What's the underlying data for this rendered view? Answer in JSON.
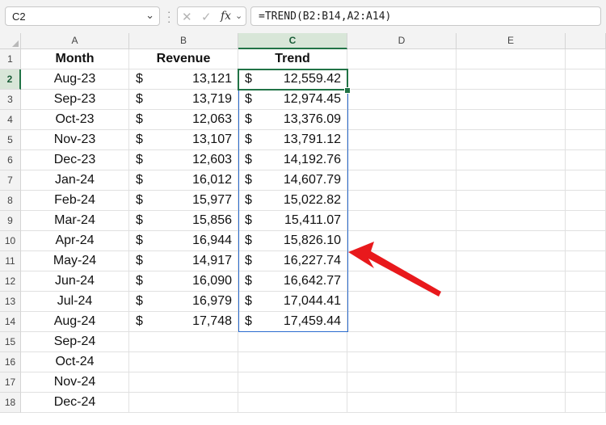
{
  "name_box": {
    "value": "C2"
  },
  "formula_bar": {
    "formula": "=TREND(B2:B14,A2:A14)",
    "fx_label": "fx"
  },
  "columns": [
    "A",
    "B",
    "C",
    "D",
    "E"
  ],
  "row_numbers": [
    "1",
    "2",
    "3",
    "4",
    "5",
    "6",
    "7",
    "8",
    "9",
    "10",
    "11",
    "12",
    "13",
    "14",
    "15",
    "16",
    "17",
    "18"
  ],
  "headers": {
    "month": "Month",
    "revenue": "Revenue",
    "trend": "Trend"
  },
  "currency_symbol": "$",
  "rows": [
    {
      "month": "Aug-23",
      "revenue": "13,121",
      "trend": "12,559.42"
    },
    {
      "month": "Sep-23",
      "revenue": "13,719",
      "trend": "12,974.45"
    },
    {
      "month": "Oct-23",
      "revenue": "12,063",
      "trend": "13,376.09"
    },
    {
      "month": "Nov-23",
      "revenue": "13,107",
      "trend": "13,791.12"
    },
    {
      "month": "Dec-23",
      "revenue": "12,603",
      "trend": "14,192.76"
    },
    {
      "month": "Jan-24",
      "revenue": "16,012",
      "trend": "14,607.79"
    },
    {
      "month": "Feb-24",
      "revenue": "15,977",
      "trend": "15,022.82"
    },
    {
      "month": "Mar-24",
      "revenue": "15,856",
      "trend": "15,411.07"
    },
    {
      "month": "Apr-24",
      "revenue": "16,944",
      "trend": "15,826.10"
    },
    {
      "month": "May-24",
      "revenue": "14,917",
      "trend": "16,227.74"
    },
    {
      "month": "Jun-24",
      "revenue": "16,090",
      "trend": "16,642.77"
    },
    {
      "month": "Jul-24",
      "revenue": "16,979",
      "trend": "17,044.41"
    },
    {
      "month": "Aug-24",
      "revenue": "17,748",
      "trend": "17,459.44"
    },
    {
      "month": "Sep-24",
      "revenue": "",
      "trend": ""
    },
    {
      "month": "Oct-24",
      "revenue": "",
      "trend": ""
    },
    {
      "month": "Nov-24",
      "revenue": "",
      "trend": ""
    },
    {
      "month": "Dec-24",
      "revenue": "",
      "trend": ""
    }
  ],
  "selection": {
    "active_cell": "C2",
    "range": "C2:C14",
    "active_column": "C",
    "active_row": "2"
  },
  "annotation": {
    "type": "red-arrow-icon",
    "points_to_row": "10",
    "color": "#e8191c"
  },
  "theme": {
    "accent": "#217346",
    "range_border": "#2b6ccf"
  }
}
